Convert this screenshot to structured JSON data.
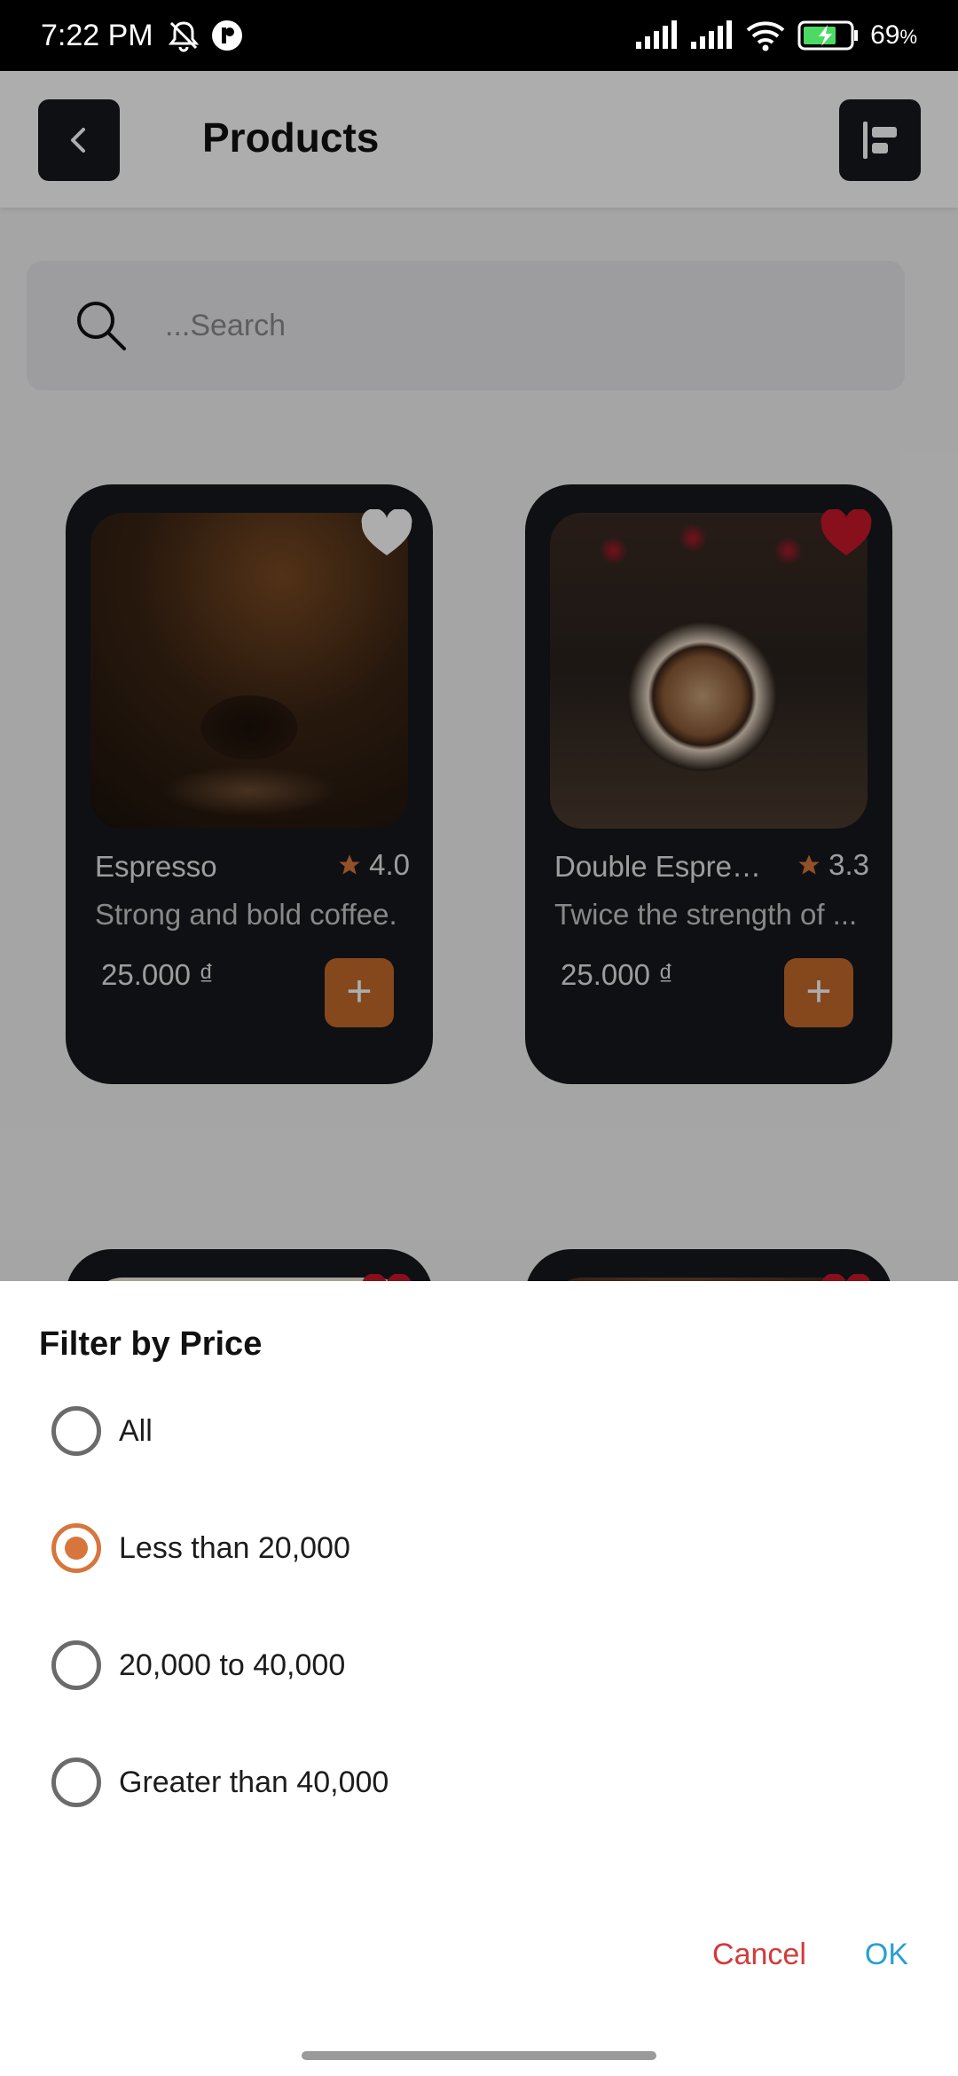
{
  "status_bar": {
    "time": "7:22 PM",
    "battery_percent": "69",
    "battery_unit": "%",
    "icons": [
      "muted-bell-icon",
      "app-notification-icon",
      "signal-icon",
      "signal-icon",
      "wifi-icon",
      "battery-charging-icon"
    ]
  },
  "header": {
    "title": "Products",
    "back_icon": "chevron-left-icon",
    "menu_icon": "filter-list-icon"
  },
  "search": {
    "placeholder": "...Search"
  },
  "products": [
    {
      "name": "Espresso",
      "rating": "4.0",
      "description": "Strong and bold coffee.",
      "price": "25.000 ₫",
      "favorite": false
    },
    {
      "name": "Double Espres...",
      "rating": "3.3",
      "description": "Twice the strength of ...",
      "price": "25.000 ₫",
      "favorite": true
    },
    {
      "favorite": true
    },
    {
      "favorite": true
    }
  ],
  "add_label": "+",
  "filter_sheet": {
    "title": "Filter by Price",
    "options": [
      {
        "label": "All",
        "selected": false
      },
      {
        "label": "Less than 20,000",
        "selected": true
      },
      {
        "label": "20,000 to 40,000",
        "selected": false
      },
      {
        "label": "Greater than 40,000",
        "selected": false
      }
    ],
    "cancel_label": "Cancel",
    "ok_label": "OK"
  },
  "colors": {
    "accent": "#d6763c",
    "card_bg": "#16181d",
    "favorite_red": "#c8182a",
    "cancel": "#d33a3a",
    "ok": "#2a9fd0"
  }
}
